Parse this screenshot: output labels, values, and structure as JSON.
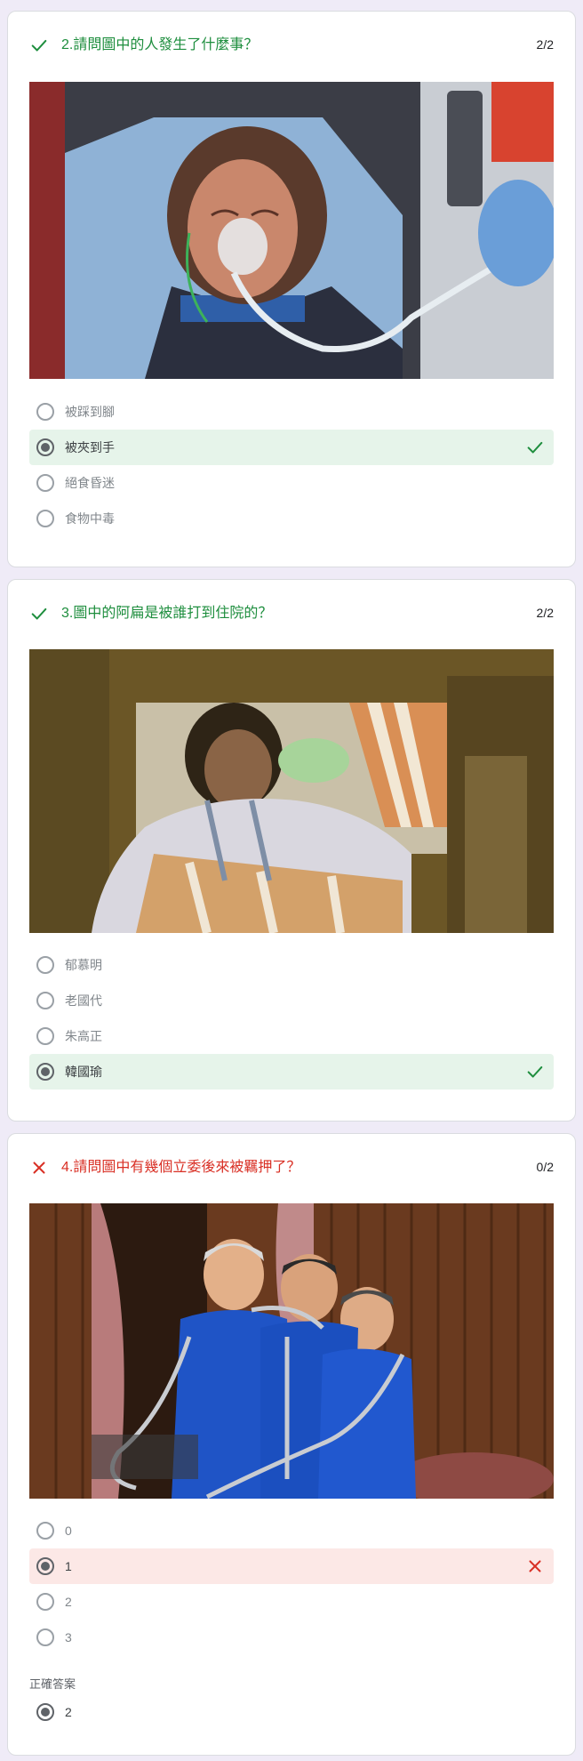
{
  "questions": [
    {
      "title": "2.請問圖中的人發生了什麼事？",
      "score": "2/2",
      "status": "correct",
      "options": [
        "被踩到腳",
        "被夾到手",
        "絕食昏迷",
        "食物中毒"
      ],
      "selected_index": 1
    },
    {
      "title": "3.圖中的阿扁是被誰打到住院的？",
      "score": "2/2",
      "status": "correct",
      "options": [
        "郁慕明",
        "老國代",
        "朱高正",
        "韓國瑜"
      ],
      "selected_index": 3
    },
    {
      "title": "4.請問圖中有幾個立委後來被羈押了？",
      "score": "0/2",
      "status": "wrong",
      "options": [
        "0",
        "1",
        "2",
        "3"
      ],
      "selected_index": 1,
      "correct_answer_heading": "正確答案",
      "correct_answer": "2"
    }
  ],
  "icons": {
    "correct": "checkmark-icon",
    "wrong": "cross-icon"
  },
  "colors": {
    "page_background": "#efebf7",
    "correct": "#1e8e3e",
    "correct_highlight": "#e6f4ea",
    "wrong": "#d93025",
    "wrong_highlight": "#fce8e6"
  }
}
